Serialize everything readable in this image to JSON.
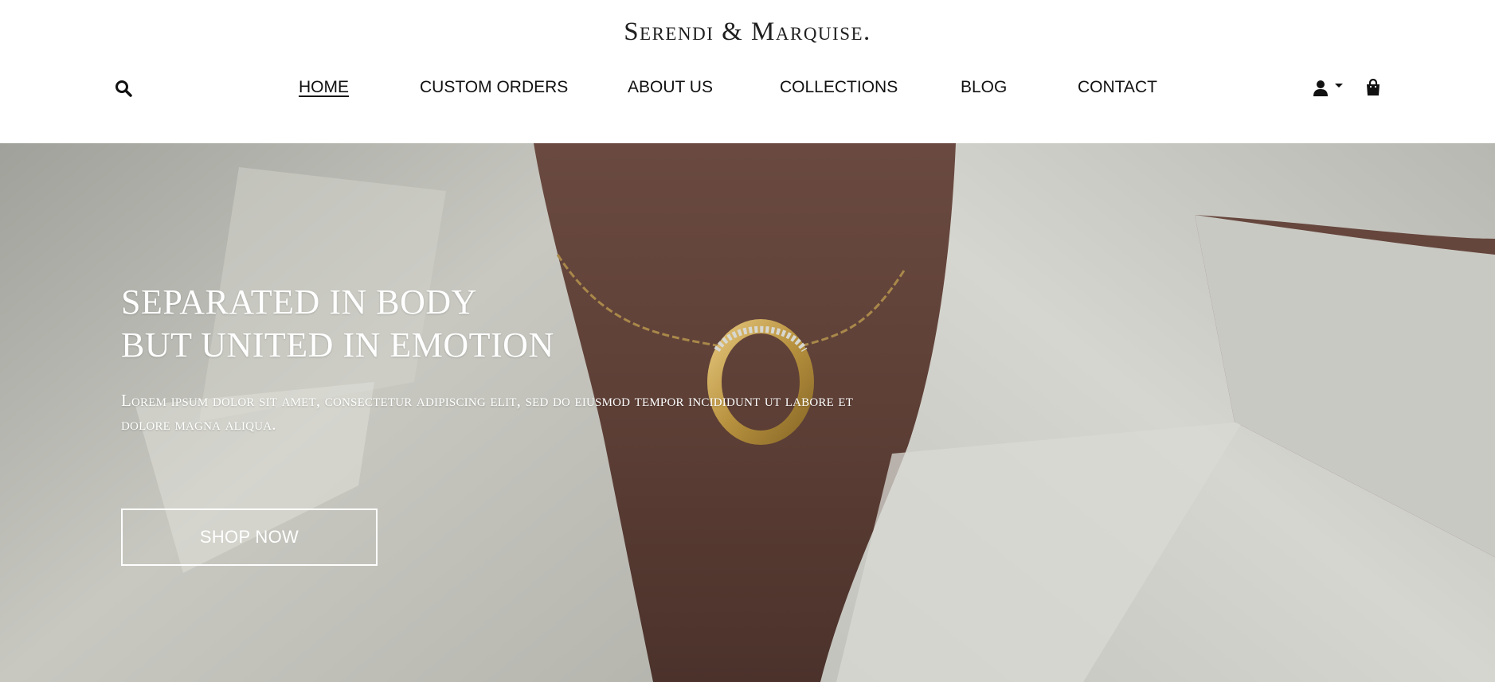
{
  "brand": {
    "name": "Serendi & Marquise."
  },
  "nav": {
    "items": [
      {
        "label": "HOME",
        "active": true
      },
      {
        "label": "CUSTOM ORDERS",
        "active": false
      },
      {
        "label": "ABOUT US",
        "active": false
      },
      {
        "label": "COLLECTIONS",
        "active": false
      },
      {
        "label": "BLOG",
        "active": false
      },
      {
        "label": "CONTACT",
        "active": false
      }
    ]
  },
  "icons": {
    "search": "search-icon",
    "user": "user-icon",
    "caret": "caret-down-icon",
    "bag": "shopping-bag-icon"
  },
  "hero": {
    "title_line1": "SEPARATED IN BODY",
    "title_line2": "BUT UNITED IN EMOTION",
    "subtitle": "Lorem ipsum dolor sit amet, consectetur adipiscing elit, sed do eiusmod tempor incididunt ut labore et dolore magna aliqua.",
    "cta_label": "SHOP NOW"
  },
  "colors": {
    "header_bg": "#ffffff",
    "text_dark": "#111111",
    "hero_text": "#ffffff",
    "jacket": "#c9c9c2",
    "skin": "#6b4c42",
    "gold": "#b8923f"
  }
}
